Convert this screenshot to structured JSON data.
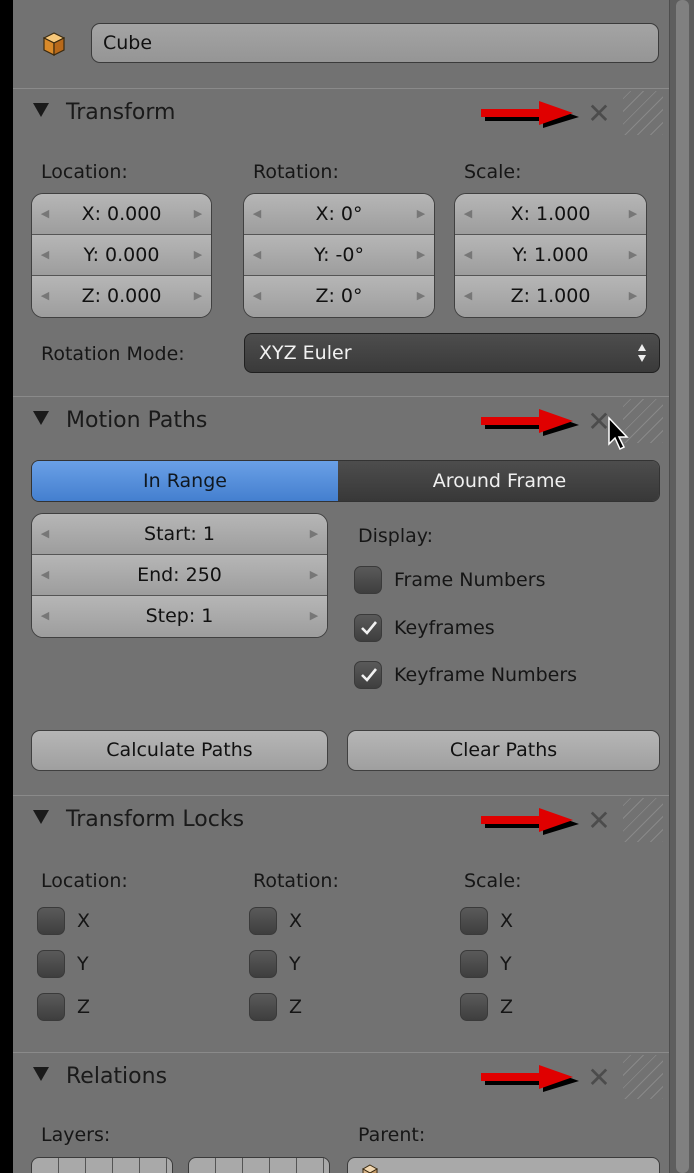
{
  "object": {
    "name": "Cube"
  },
  "panels": {
    "transform": {
      "title": "Transform",
      "location_label": "Location:",
      "rotation_label": "Rotation:",
      "scale_label": "Scale:",
      "location": [
        "X: 0.000",
        "Y: 0.000",
        "Z: 0.000"
      ],
      "rotation": [
        "X: 0°",
        "Y: -0°",
        "Z: 0°"
      ],
      "scale": [
        "X: 1.000",
        "Y: 1.000",
        "Z: 1.000"
      ],
      "rotation_mode_label": "Rotation Mode:",
      "rotation_mode": "XYZ Euler"
    },
    "motion_paths": {
      "title": "Motion Paths",
      "tab_in_range": "In Range",
      "tab_around_frame": "Around Frame",
      "start": "Start: 1",
      "end": "End: 250",
      "step": "Step: 1",
      "display_label": "Display:",
      "options": [
        {
          "label": "Frame Numbers",
          "checked": false
        },
        {
          "label": "Keyframes",
          "checked": true
        },
        {
          "label": "Keyframe Numbers",
          "checked": true
        }
      ],
      "calculate_button": "Calculate Paths",
      "clear_button": "Clear Paths"
    },
    "transform_locks": {
      "title": "Transform Locks",
      "location_label": "Location:",
      "rotation_label": "Rotation:",
      "scale_label": "Scale:",
      "axes": [
        "X",
        "Y",
        "Z"
      ]
    },
    "relations": {
      "title": "Relations",
      "layers_label": "Layers:",
      "parent_label": "Parent:"
    }
  },
  "colors": {
    "panel_bg": "#727272",
    "active_tab": "#5a92de",
    "annotation_arrow": "#e00000"
  },
  "icons": [
    "cube-icon",
    "collapse-triangle-icon",
    "close-icon",
    "red-arrow-annotation",
    "updown-chevron-icon",
    "checkmark-icon",
    "mouse-cursor-icon"
  ]
}
